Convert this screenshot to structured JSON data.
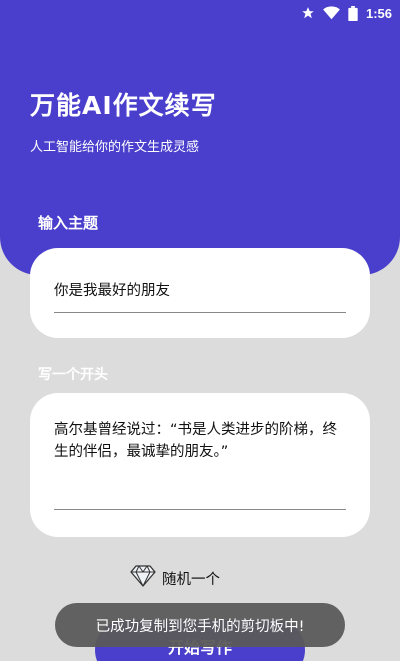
{
  "status_bar": {
    "time": "1:56",
    "icons": [
      "star-icon",
      "wifi-icon",
      "battery-icon"
    ]
  },
  "header": {
    "title": "万能AI作文续写",
    "subtitle": "人工智能给你的作文生成灵感"
  },
  "topic": {
    "label": "输入主题",
    "value": "你是我最好的朋友"
  },
  "opening": {
    "label": "写一个开头",
    "value": "高尔基曾经说过：“书是人类进步的阶梯，终生的伴侣，最诚挚的朋友。”"
  },
  "random": {
    "label": "随机一个",
    "icon": "diamond-icon"
  },
  "start_button": {
    "label": "开始写作"
  },
  "toast": {
    "message": "已成功复制到您手机的剪切板中!"
  },
  "colors": {
    "accent": "#4a3fcc",
    "background": "#dcdcdc",
    "card": "#ffffff",
    "toast": "#5a5a5a"
  }
}
